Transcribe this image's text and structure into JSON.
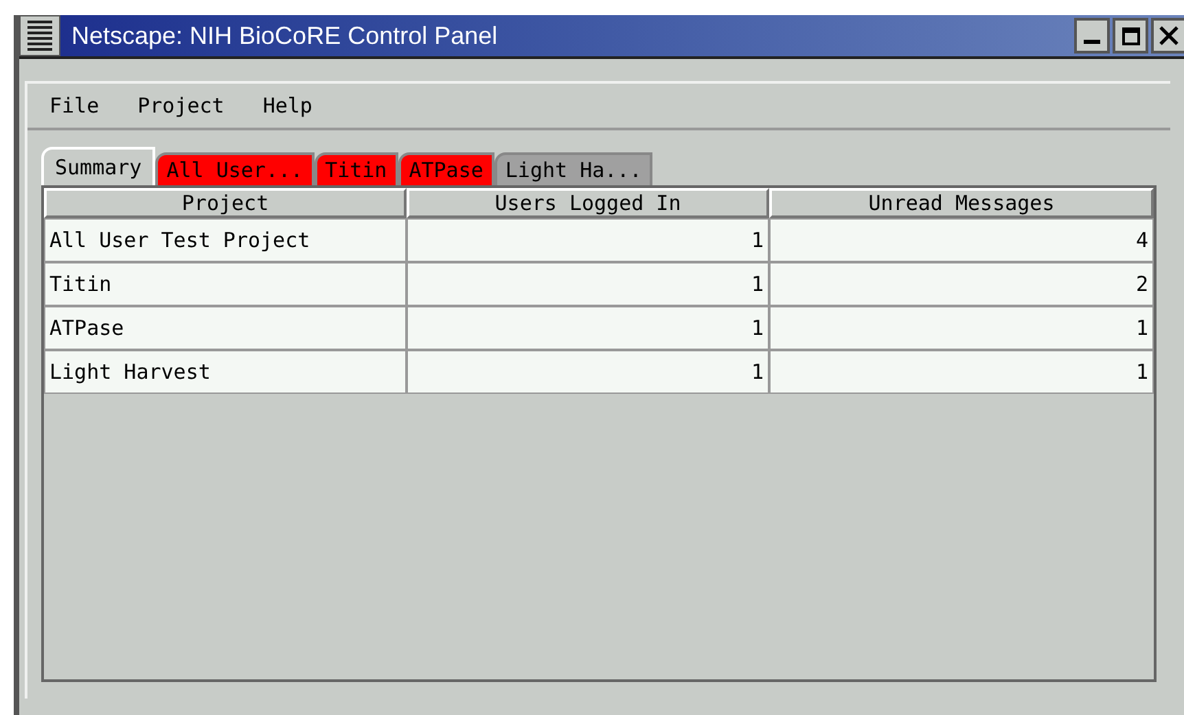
{
  "window": {
    "title": "Netscape: NIH BioCoRE Control Panel"
  },
  "menu": [
    {
      "label": "File"
    },
    {
      "label": "Project"
    },
    {
      "label": "Help"
    }
  ],
  "tabs": [
    {
      "label": "Summary",
      "selected": true,
      "color": "#c8ccc8"
    },
    {
      "label": "All User...",
      "selected": false,
      "color": "#ff0000"
    },
    {
      "label": "Titin",
      "selected": false,
      "color": "#ff0000"
    },
    {
      "label": "ATPase",
      "selected": false,
      "color": "#ff0000"
    },
    {
      "label": "Light Ha...",
      "selected": false,
      "color": "#a0a0a0"
    }
  ],
  "table": {
    "columns": [
      "Project",
      "Users Logged In",
      "Unread Messages"
    ],
    "rows": [
      [
        "All User Test Project",
        "1",
        "4"
      ],
      [
        "Titin",
        "1",
        "2"
      ],
      [
        "ATPase",
        "1",
        "1"
      ],
      [
        "Light Harvest",
        "1",
        "1"
      ]
    ]
  }
}
